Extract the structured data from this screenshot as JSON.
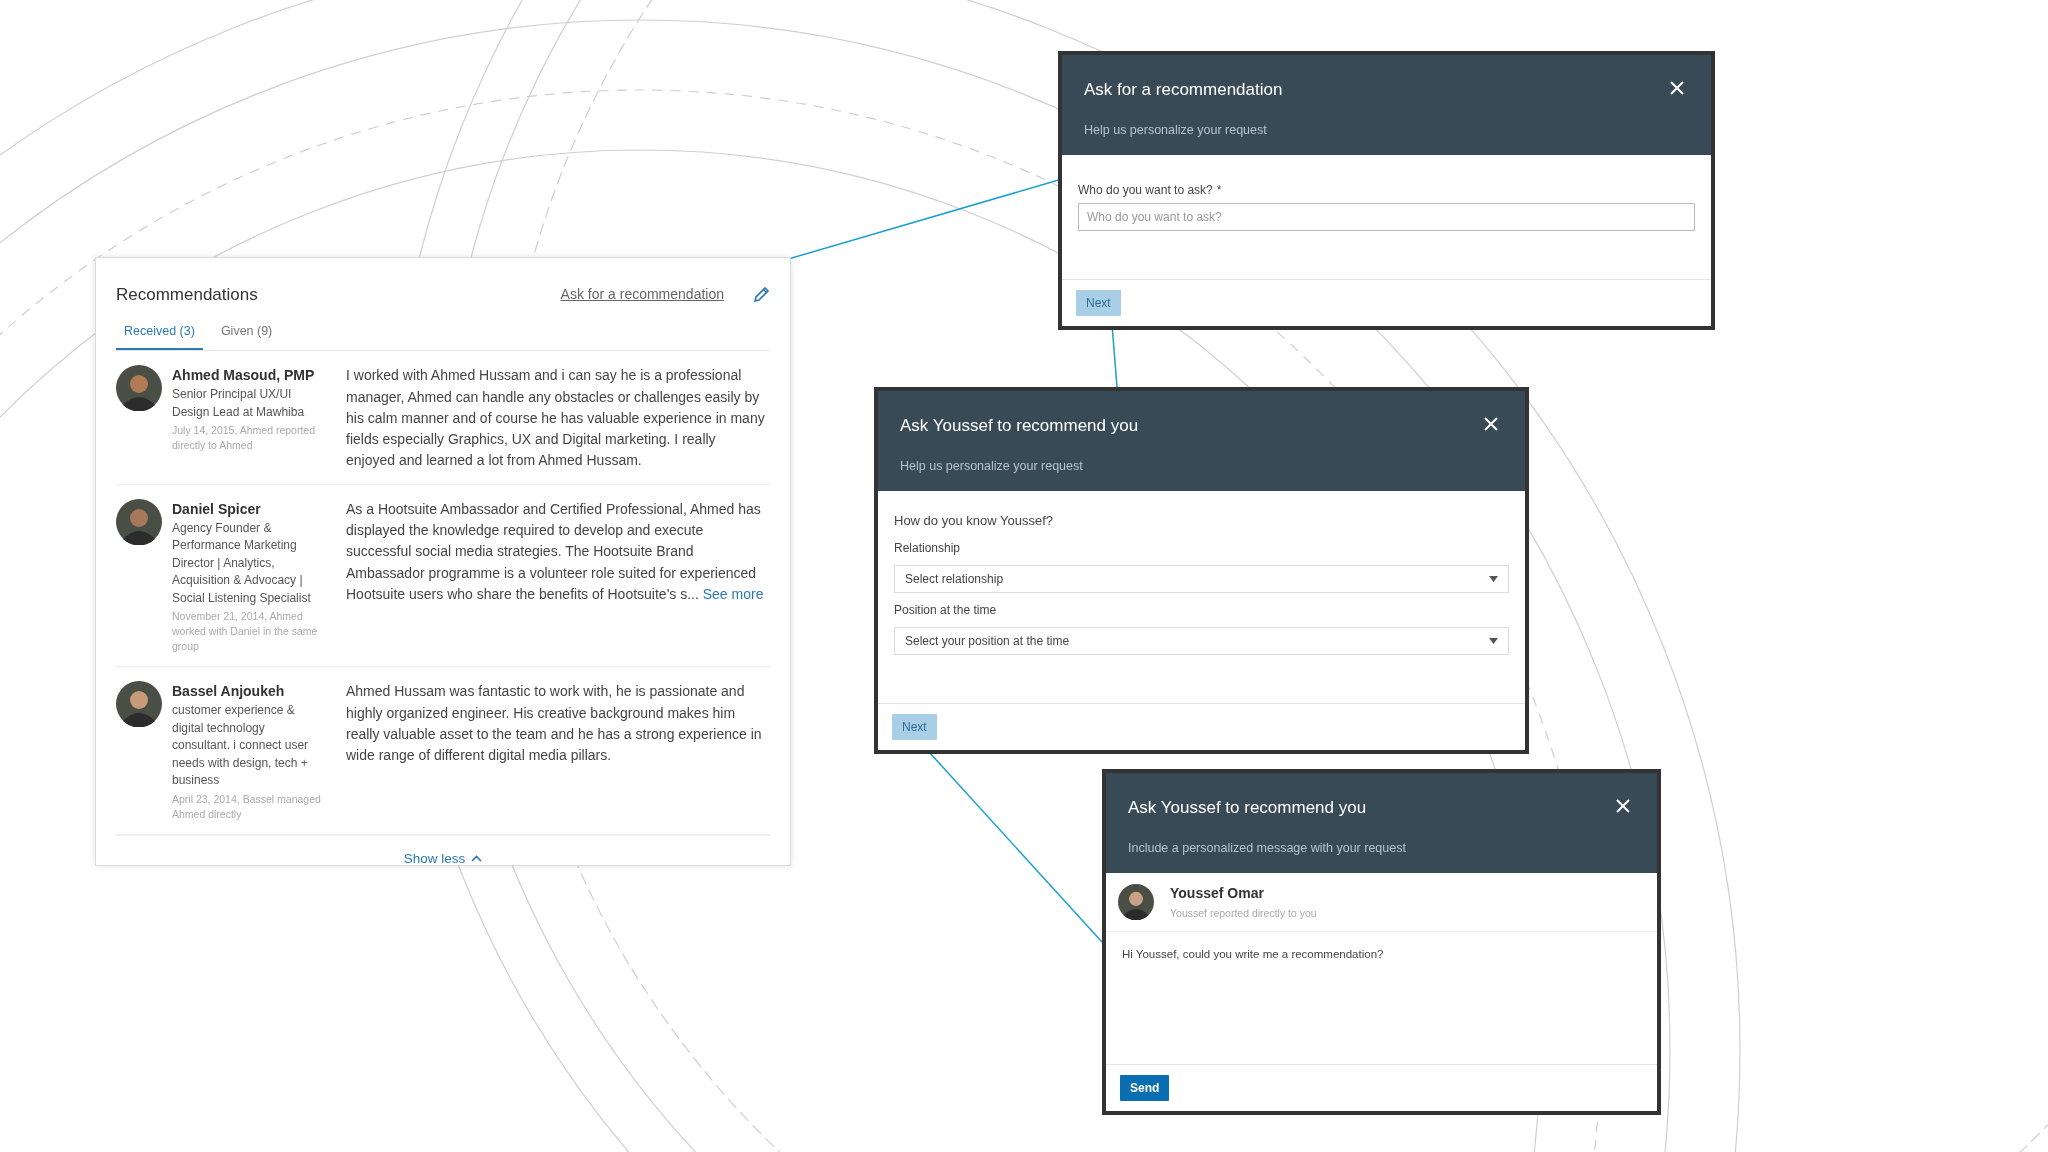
{
  "recommendations_panel": {
    "title": "Recommendations",
    "ask_link": "Ask for a recommendation",
    "tabs": [
      {
        "label": "Received (3)",
        "selected": true
      },
      {
        "label": "Given (9)",
        "selected": false
      }
    ],
    "items": [
      {
        "name": "Ahmed Masoud, PMP",
        "headline": "Senior Principal UX/UI Design Lead at Mawhiba",
        "meta": "July 14, 2015, Ahmed reported directly to Ahmed",
        "text": "I worked with Ahmed Hussam and i can say he is a professional manager, Ahmed can handle any obstacles or challenges easily by his calm manner and of course he has valuable experience in many fields especially Graphics, UX and Digital marketing. I really enjoyed and learned a lot from Ahmed Hussam."
      },
      {
        "name": "Daniel Spicer",
        "headline": "Agency Founder & Performance Marketing Director | Analytics, Acquisition & Advocacy | Social Listening Specialist",
        "meta": "November 21, 2014, Ahmed worked with Daniel in the same group",
        "text": "As a Hootsuite Ambassador and Certified Professional, Ahmed has displayed the knowledge required to develop and execute successful social media strategies. The Hootsuite Brand Ambassador programme is a volunteer role suited for experienced Hootsuite users who share the benefits of Hootsuite's s...",
        "more_link": "See more"
      },
      {
        "name": "Bassel Anjoukeh",
        "headline": "customer experience & digital technology consultant. i connect user needs with design, tech + business",
        "meta": "April 23, 2014, Bassel managed Ahmed directly",
        "text": "Ahmed Hussam was fantastic to work with, he is passionate and highly organized engineer. His creative background makes him really valuable asset to the team and he has a strong experience in wide range of different digital media pillars."
      }
    ],
    "footer_link": "Show less"
  },
  "dialogs": [
    {
      "kind": "ask",
      "title": "Ask for a recommendation",
      "subtitle": "Help us personalize your request",
      "field_label": "Who do you want to ask?",
      "required_mark": "*",
      "placeholder": "Who do you want to ask?",
      "button": {
        "label": "Next",
        "disabled": true
      }
    },
    {
      "kind": "relationship",
      "title": "Ask Youssef to recommend you",
      "subtitle": "Help us personalize your request",
      "question": "How do you know Youssef?",
      "selects": [
        {
          "label": "Relationship",
          "placeholder": "Select relationship"
        },
        {
          "label": "Position at the time",
          "placeholder": "Select your position at the time"
        }
      ],
      "button": {
        "label": "Next",
        "disabled": true
      }
    },
    {
      "kind": "message",
      "title": "Ask Youssef to recommend you",
      "subtitle": "Include a personalized message with your request",
      "contact": {
        "name": "Youssef Omar",
        "note": "Youssef reported directly to you"
      },
      "message": "Hi Youssef, could you write me a recommendation?",
      "button": {
        "label": "Send",
        "disabled": false
      }
    }
  ]
}
